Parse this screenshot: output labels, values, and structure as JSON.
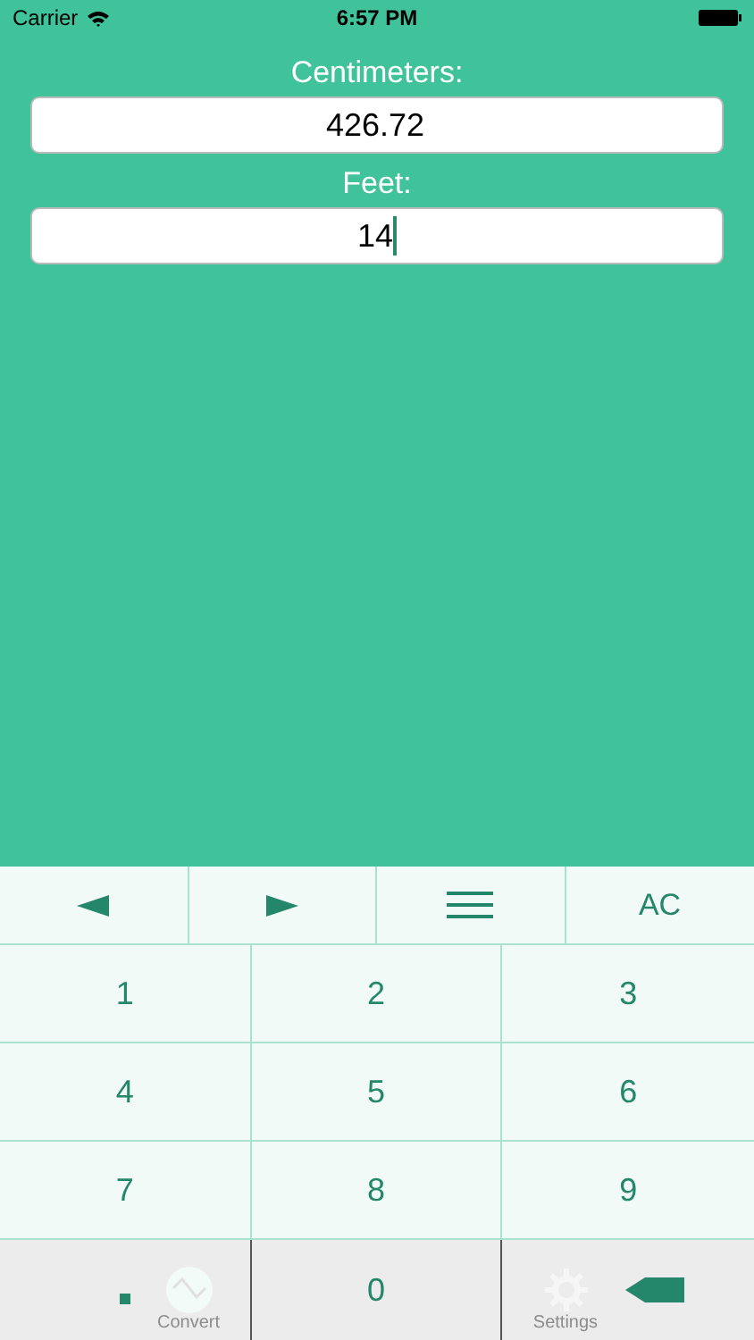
{
  "status_bar": {
    "carrier": "Carrier",
    "time": "6:57 PM"
  },
  "fields": [
    {
      "label": "Centimeters:",
      "value": "426.72",
      "focused": false
    },
    {
      "label": "Feet:",
      "value": "14",
      "focused": true
    }
  ],
  "toolbar": [
    {
      "kind": "left"
    },
    {
      "kind": "right"
    },
    {
      "kind": "menu"
    },
    {
      "kind": "text",
      "label": "AC"
    }
  ],
  "keys": [
    {
      "kind": "text",
      "label": "1"
    },
    {
      "kind": "text",
      "label": "2"
    },
    {
      "kind": "text",
      "label": "3"
    },
    {
      "kind": "text",
      "label": "4"
    },
    {
      "kind": "text",
      "label": "5"
    },
    {
      "kind": "text",
      "label": "6"
    },
    {
      "kind": "text",
      "label": "7"
    },
    {
      "kind": "text",
      "label": "8"
    },
    {
      "kind": "text",
      "label": "9"
    },
    {
      "kind": "dot"
    },
    {
      "kind": "text",
      "label": "0"
    },
    {
      "kind": "backspace"
    }
  ],
  "tab_bar": [
    {
      "kind": "wave",
      "label": "Convert"
    },
    {
      "kind": "gear",
      "label": "Settings"
    }
  ]
}
